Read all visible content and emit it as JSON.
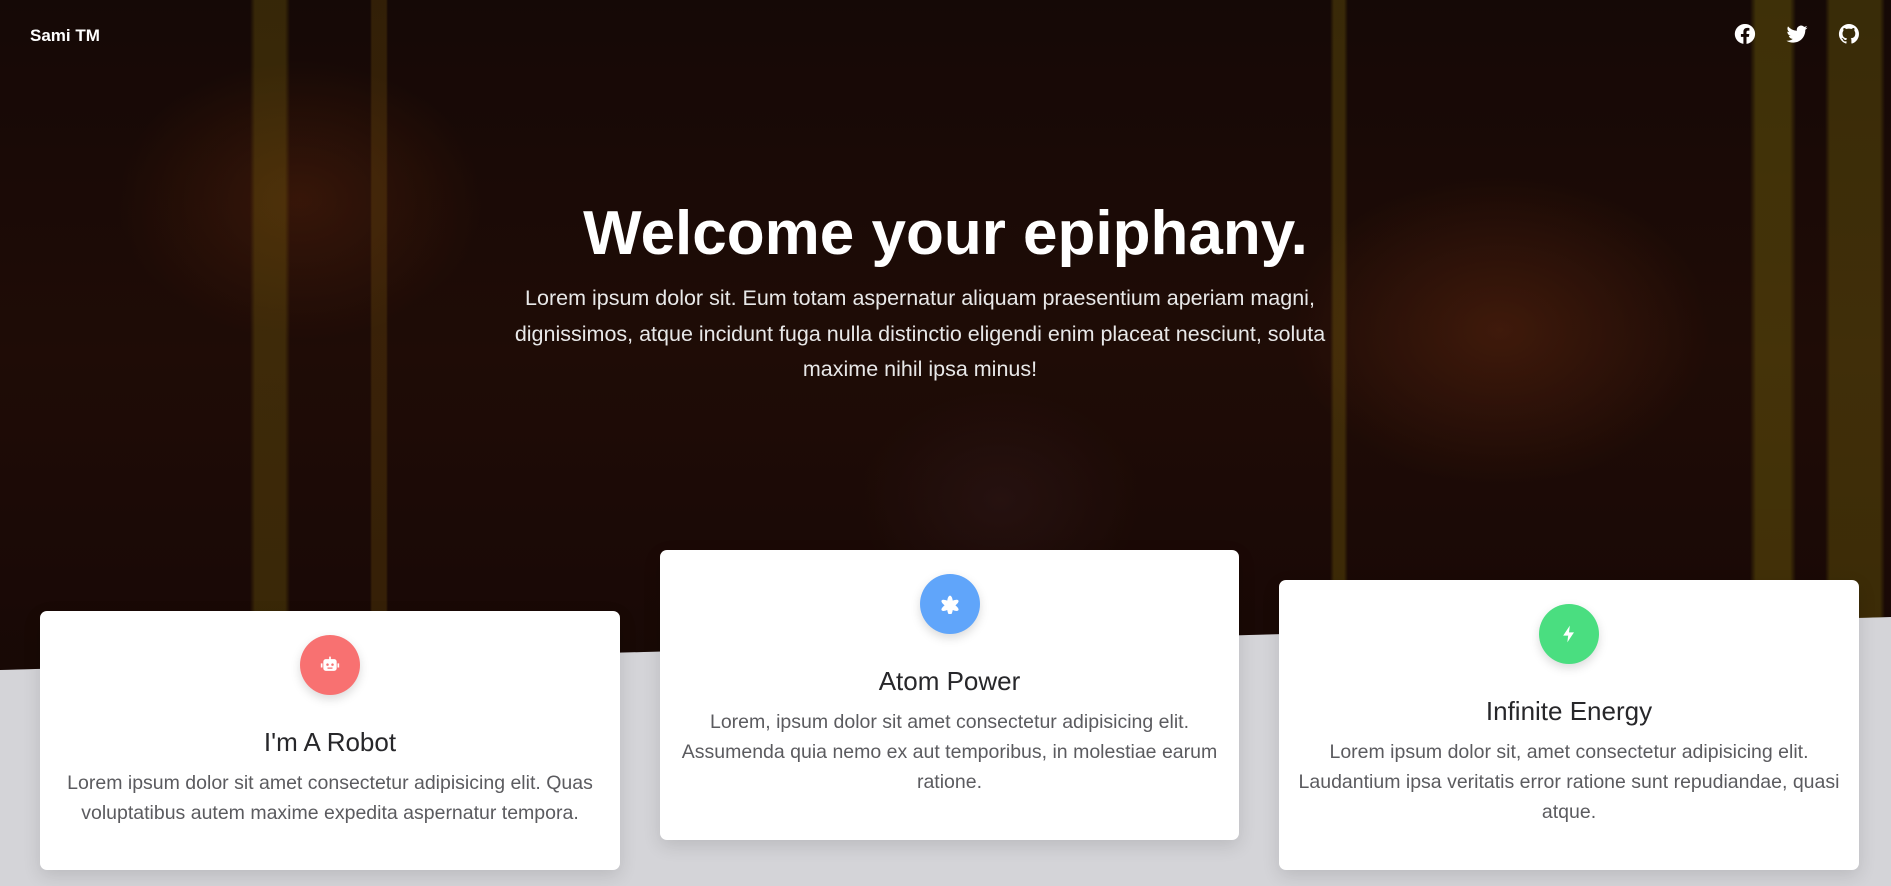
{
  "brand": "Sami TM",
  "social": [
    {
      "icon": "facebook-icon"
    },
    {
      "icon": "twitter-icon"
    },
    {
      "icon": "github-icon"
    }
  ],
  "hero": {
    "title": "Welcome your epiphany.",
    "subtitle": "Lorem ipsum dolor sit. Eum totam aspernatur aliquam praesentium aperiam magni, dignissimos, atque incidunt fuga nulla distinctio eligendi enim placeat nesciunt, soluta maxime nihil ipsa minus!"
  },
  "cards": [
    {
      "title": "I'm A Robot",
      "text": "Lorem ipsum dolor sit amet consectetur adipisicing elit. Quas voluptatibus autem maxime expedita aspernatur tempora.",
      "icon": "robot-icon",
      "color": "#f87171"
    },
    {
      "title": "Atom Power",
      "text": "Lorem, ipsum dolor sit amet consectetur adipisicing elit. Assumenda quia nemo ex aut temporibus, in molestiae earum ratione.",
      "icon": "atom-icon",
      "color": "#60a5fa"
    },
    {
      "title": "Infinite Energy",
      "text": "Lorem ipsum dolor sit, amet consectetur adipisicing elit. Laudantium ipsa veritatis error ratione sunt repudiandae, quasi atque.",
      "icon": "lightning-bolt-icon",
      "color": "#4ade80"
    }
  ]
}
